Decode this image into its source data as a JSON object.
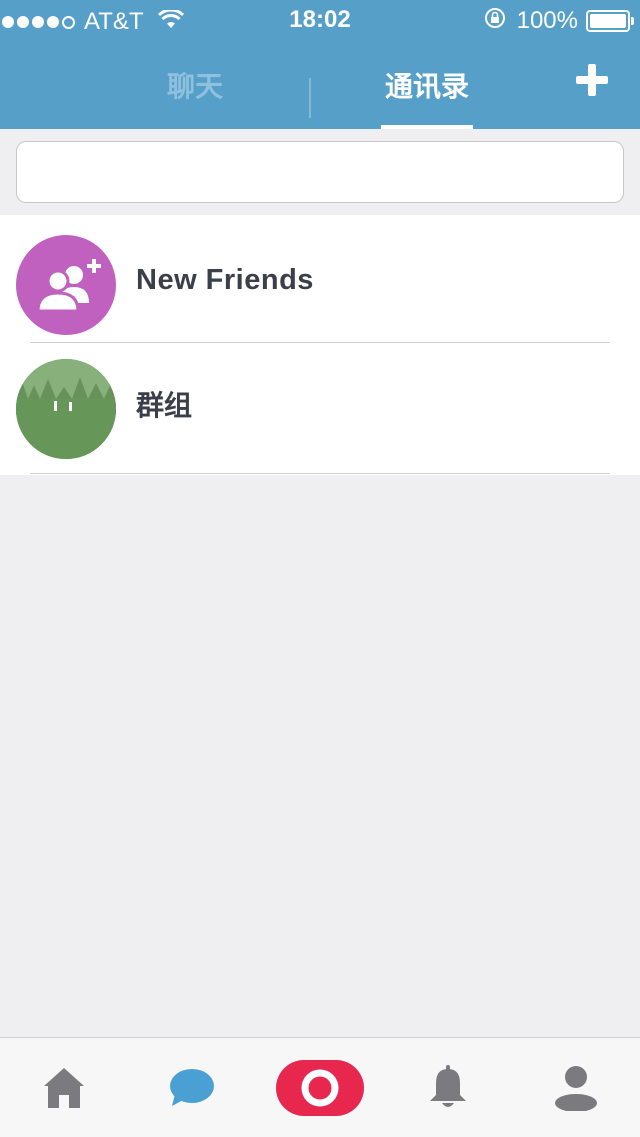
{
  "status_bar": {
    "carrier": "AT&T",
    "time": "18:02",
    "battery": "100%",
    "signal_dots_filled": 4,
    "signal_dots_total": 5
  },
  "header": {
    "tabs": [
      {
        "label": "聊天",
        "active": false
      },
      {
        "label": "通讯录",
        "active": true
      }
    ],
    "add_icon": "plus-icon",
    "background": "#569fc9"
  },
  "search": {
    "placeholder": "",
    "value": ""
  },
  "contacts": {
    "items": [
      {
        "label": "New Friends",
        "icon": "add-friends-icon",
        "avatar_color": "#c060bf"
      },
      {
        "label": "群组",
        "icon": "group-avatar",
        "avatar_color": "#6f9f62"
      }
    ]
  },
  "tabbar": {
    "items": [
      {
        "icon": "home-icon",
        "active": false
      },
      {
        "icon": "chat-icon",
        "active": true
      },
      {
        "icon": "camera-record-icon",
        "active": false
      },
      {
        "icon": "bell-icon",
        "active": false
      },
      {
        "icon": "profile-icon",
        "active": false
      }
    ],
    "accent": "#e8274f",
    "chat_color": "#4a9fd3"
  }
}
